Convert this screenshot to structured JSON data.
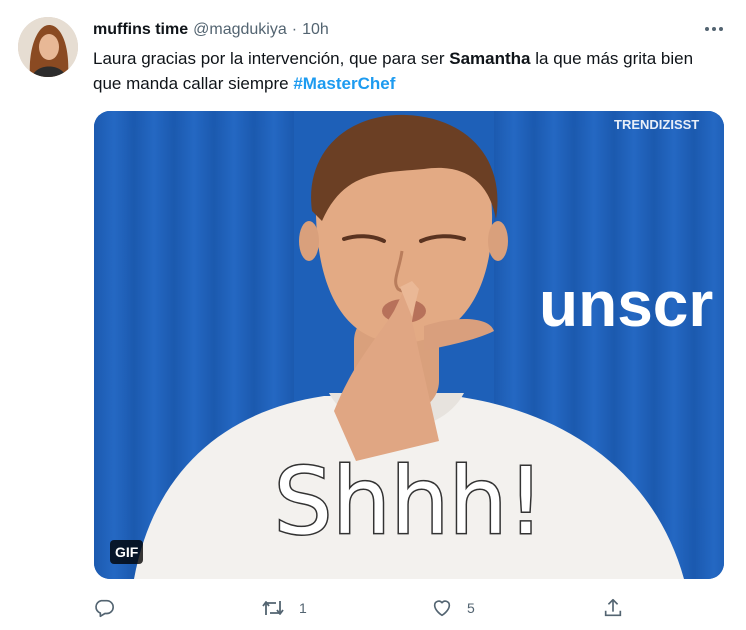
{
  "tweet": {
    "author_name": "muffins time",
    "author_handle": "@magdukiya",
    "separator": "·",
    "time": "10h",
    "text_before": "Laura gracias por la intervención, que para ser ",
    "text_bold": "Samantha",
    "text_after": " la que más grita bien que manda callar siempre ",
    "hashtag": "#MasterChef"
  },
  "media": {
    "type": "gif",
    "badge": "GIF",
    "watermark": "TRENDIZISST",
    "backdrop_text": "unscr",
    "caption": "Shhh!",
    "backdrop_color": "#1e60b8"
  },
  "actions": {
    "reply": {
      "icon": "reply-icon",
      "count": ""
    },
    "retweet": {
      "icon": "retweet-icon",
      "count": "1"
    },
    "like": {
      "icon": "heart-icon",
      "count": "5"
    },
    "share": {
      "icon": "share-icon"
    }
  },
  "colors": {
    "text": "#0f1419",
    "secondary": "#536471",
    "link": "#1d9bf0"
  }
}
